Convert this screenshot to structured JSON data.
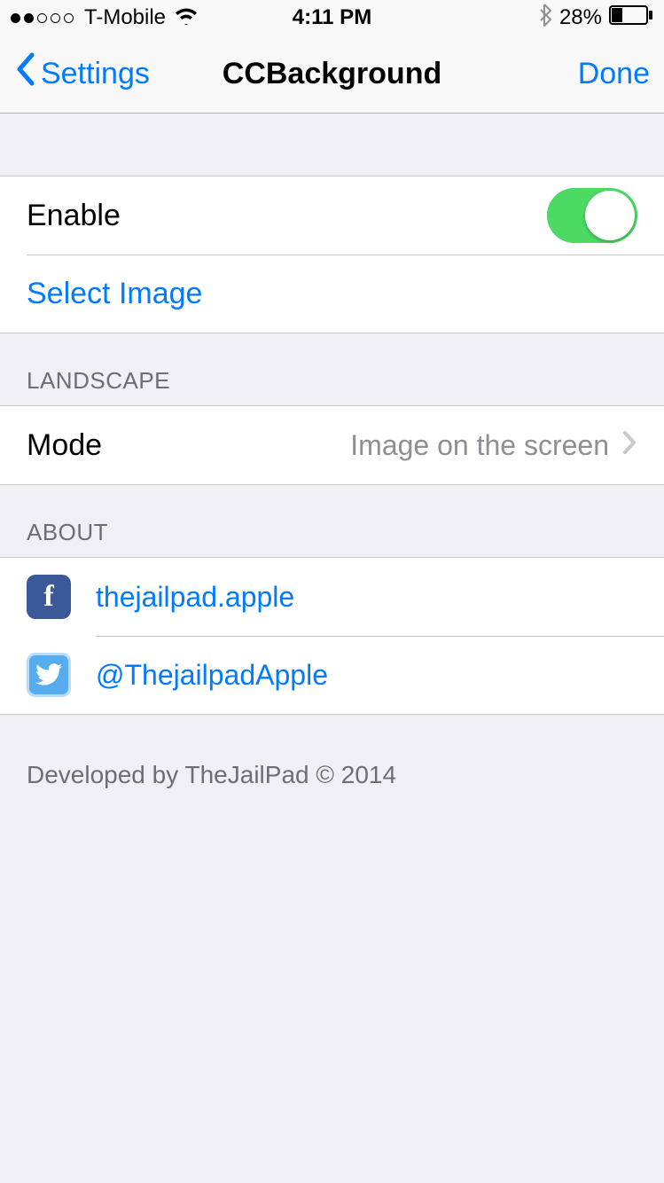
{
  "status": {
    "carrier": "T-Mobile",
    "time": "4:11 PM",
    "battery_pct": "28%"
  },
  "nav": {
    "back_label": "Settings",
    "title": "CCBackground",
    "done_label": "Done"
  },
  "group1": {
    "enable_label": "Enable",
    "enable_on": true,
    "select_image_label": "Select Image"
  },
  "landscape": {
    "header": "Landscape",
    "mode_label": "Mode",
    "mode_value": "Image on the screen"
  },
  "about": {
    "header": "About",
    "facebook_label": "thejailpad.apple",
    "twitter_label": "@ThejailpadApple"
  },
  "footer": {
    "text": "Developed by TheJailPad © 2014"
  }
}
